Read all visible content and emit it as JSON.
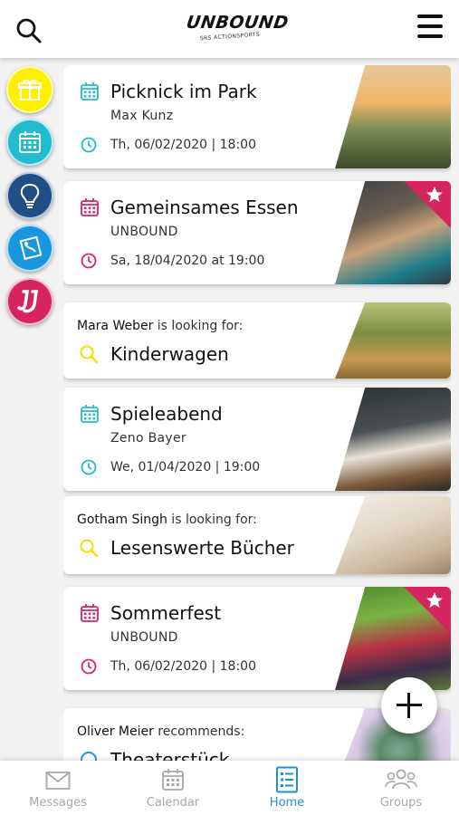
{
  "app": {
    "logo_text": "UNBOUND",
    "logo_subtext": "SRS ACTIONSPORTS"
  },
  "header": {
    "search_icon": "search-icon",
    "menu_icon": "hamburger-menu-icon"
  },
  "categories": [
    {
      "name": "gift",
      "color": "#fff000",
      "icon": "gift-icon"
    },
    {
      "name": "calendar",
      "color": "#22bcd0",
      "icon": "calendar-icon"
    },
    {
      "name": "idea",
      "color": "#1f4f86",
      "icon": "lightbulb-icon"
    },
    {
      "name": "recommend",
      "color": "#1a96e0",
      "icon": "tag-icon"
    },
    {
      "name": "unbound",
      "color": "#d6245f",
      "icon": "unbound-logo-icon"
    }
  ],
  "feed": {
    "events": [
      {
        "title": "Picknick im Park",
        "host": "Max Kunz",
        "date": "Th, 06/02/2020 | 18:00",
        "accent": "#22bcd0",
        "starred": false
      },
      {
        "title": "Gemeinsames Essen",
        "host": "UNBOUND",
        "date": "Sa, 18/04/2020 at 19:00",
        "accent": "#d6245f",
        "starred": true
      },
      {
        "title": "Spieleabend",
        "host": "Zeno Bayer",
        "date": "We, 01/04/2020 | 19:00",
        "accent": "#22bcd0",
        "starred": false
      },
      {
        "title": "Sommerfest",
        "host": "UNBOUND",
        "date": "Th, 06/02/2020 | 18:00",
        "accent": "#d6245f",
        "starred": true
      }
    ],
    "requests": [
      {
        "person": "Mara Weber",
        "phrase": " is looking for:",
        "item": "Kinderwagen"
      },
      {
        "person": "Gotham Singh",
        "phrase": " is looking for:",
        "item": "Lesenswerte Bücher"
      }
    ],
    "recommendation": {
      "person": "Oliver Meier",
      "phrase": " recommends:",
      "item": "Theaterstück"
    }
  },
  "fab": {
    "icon": "plus-icon"
  },
  "tabs": [
    {
      "label": "Messages",
      "icon": "envelope-icon",
      "active": false
    },
    {
      "label": "Calendar",
      "icon": "calendar-icon",
      "active": false
    },
    {
      "label": "Home",
      "icon": "feed-list-icon",
      "active": true
    },
    {
      "label": "Groups",
      "icon": "group-icon",
      "active": false
    }
  ],
  "colors": {
    "calendar_blue": "#22bcd0",
    "unbound_pink": "#d6245f",
    "search_yellow": "#f5e000",
    "active_tab": "#1f8fd8",
    "inactive_tab": "#a8a8a8"
  }
}
